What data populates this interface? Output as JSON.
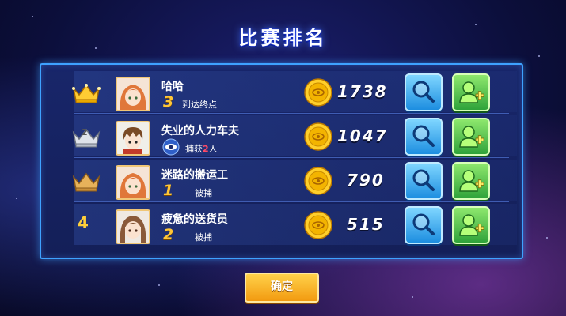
{
  "title": "比赛排名",
  "confirm_label": "确定",
  "colors": {
    "panel_border": "#3ea2ff",
    "gold": "#ffc637",
    "highlight_red": "#ff4a66",
    "search_button": "#1d8ee0",
    "add_friend_button": "#2fa33a",
    "confirm_button": "#f29a10"
  },
  "rows": [
    {
      "rank_badge": "gold-crown-icon",
      "rank_text": "",
      "avatar": "orange-haired-girl-avatar",
      "name": "哈哈",
      "number": "3",
      "status": "到达终点",
      "score": "1738"
    },
    {
      "rank_badge": "silver-crown-icon",
      "rank_text": "2",
      "avatar": "brown-haired-boy-avatar",
      "name": "失业的人力车夫",
      "capture_prefix": "捕获",
      "capture_count": "2",
      "capture_suffix": "人",
      "score": "1047"
    },
    {
      "rank_badge": "bronze-crown-icon",
      "rank_text": "",
      "avatar": "orange-haired-girl-avatar",
      "name": "迷路的搬运工",
      "number": "1",
      "status": "被捕",
      "score": "790"
    },
    {
      "rank_badge": "",
      "rank_text": "4",
      "avatar": "long-haired-girl-avatar",
      "name": "疲惫的送货员",
      "number": "2",
      "status": "被捕",
      "score": "515"
    }
  ]
}
